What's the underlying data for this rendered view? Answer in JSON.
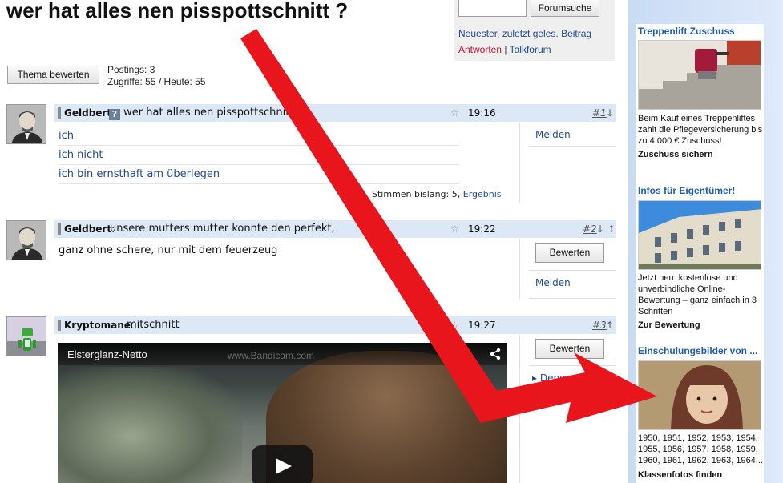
{
  "thread": {
    "title": "wer hat alles nen pisspottschnitt ?"
  },
  "search": {
    "input_value": "",
    "button_label": "Forumsuche",
    "link_latest": "Neuester, zuletzt geles. Beitrag",
    "link_reply": "Antworten",
    "separator": "|",
    "link_talk": "Talkforum"
  },
  "thread_meta": {
    "rate_button": "Thema bewerten",
    "postings": "Postings: 3",
    "views": "Zugriffe: 55 / Heute: 55"
  },
  "posts": [
    {
      "author": "Geldbert",
      "sep": ":",
      "title": "wer hat alles nen pisspottschnitt ?",
      "time": "19:16",
      "number": "#1",
      "arrows": "↓",
      "poll_options": [
        "ich",
        "ich nicht",
        "ich bin ernsthaft am überlegen"
      ],
      "votes_label": "Stimmen bislang: 5,",
      "votes_link": "Ergebnis",
      "melden": "Melden"
    },
    {
      "author": "Geldbert",
      "sep": ":",
      "title": "unsere mutters mutter konnte den perfekt,",
      "time": "19:22",
      "number": "#2",
      "arrows": "↓ ↑",
      "body": "ganz ohne schere, nur mit dem feuerzeug",
      "rate_button": "Bewerten",
      "melden": "Melden"
    },
    {
      "author": "Kryptomane",
      "sep": ":",
      "title": "mitschnitt",
      "time": "19:27",
      "number": "#3",
      "arrows": "↑",
      "rate_button": "Bewerten",
      "depot_label": "Depo",
      "video": {
        "title": "Elsterglanz-Netto",
        "watermark": "www.Bandicam.com"
      }
    }
  ],
  "ads": [
    {
      "title": "Treppenlift Zuschuss",
      "text": "Beim Kauf eines Treppenliftes zahlt die Pflegeversicherung bis zu 4.000 € Zuschuss!",
      "cta": "Zuschuss sichern"
    },
    {
      "title": "Infos für Eigentümer!",
      "text": "Jetzt neu: kostenlose und unverbindliche Online-Bewertung – ganz einfach in 3 Schritten",
      "cta": "Zur Bewertung"
    },
    {
      "title": "Einschulungsbilder von ...",
      "text": "1950, 1951, 1952, 1953, 1954, 1955, 1956, 1957, 1958, 1959, 1960, 1961, 1962, 1963, 1964...",
      "cta": "Klassenfotos finden"
    }
  ],
  "colors": {
    "accent_red_arrow": "#e8151c",
    "post_header_bg": "#dde8f7",
    "link": "#214a90",
    "ad_title": "#1f5bb4"
  }
}
